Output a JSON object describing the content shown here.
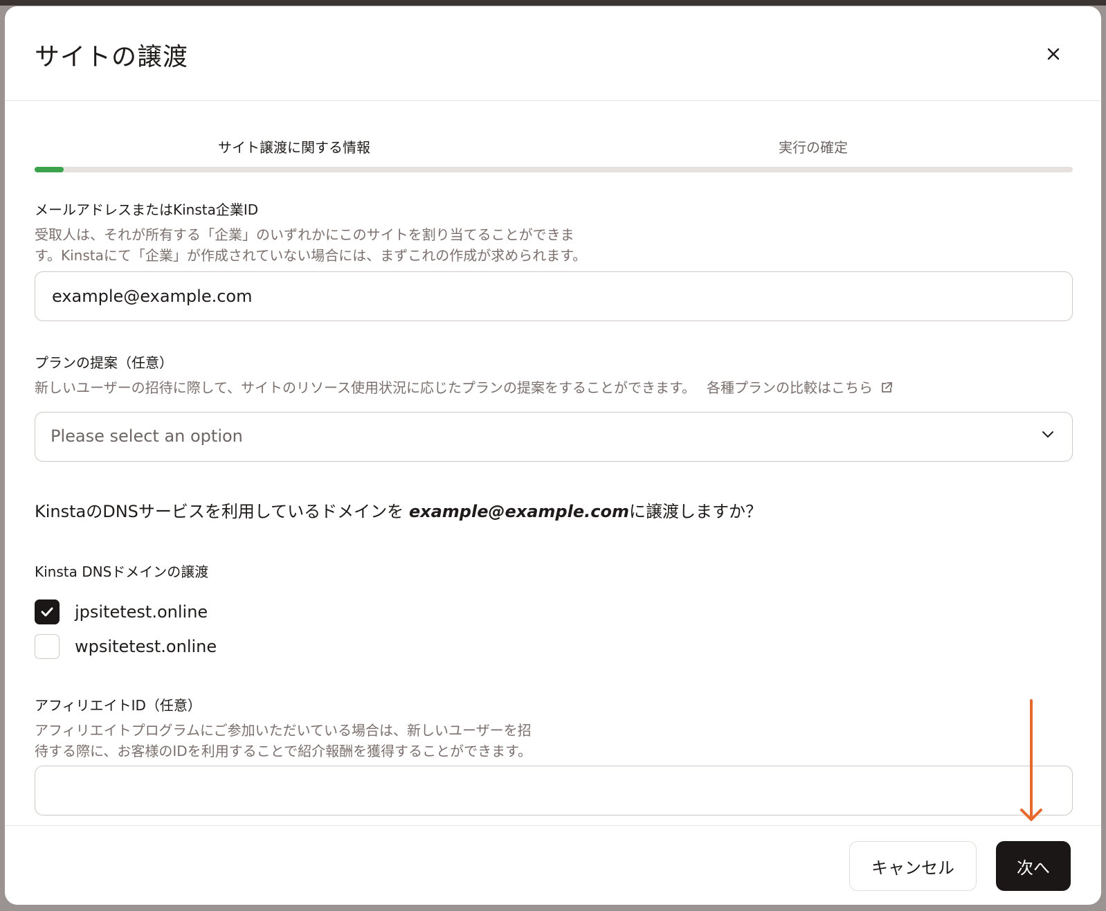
{
  "modal": {
    "title": "サイトの譲渡",
    "steps": [
      {
        "label": "サイト譲渡に関する情報"
      },
      {
        "label": "実行の確定"
      }
    ],
    "progress_fraction": 0.028
  },
  "email_field": {
    "label": "メールアドレスまたはKinsta企業ID",
    "help_line1": "受取人は、それが所有する「企業」のいずれかにこのサイトを割り当てることができま",
    "help_line2": "す。Kinstaにて「企業」が作成されていない場合には、まずこれの作成が求められます。",
    "value": "example@example.com"
  },
  "plan_field": {
    "label": "プランの提案（任意）",
    "help": "新しいユーザーの招待に際して、サイトのリソース使用状況に応じたプランの提案をすることができます。",
    "compare_link": "各種プランの比較はこちら",
    "placeholder": "Please select an option"
  },
  "dns_question": {
    "prefix": "KinstaのDNSサービスを利用しているドメインを ",
    "email": "example@example.com",
    "suffix": "に譲渡しますか？"
  },
  "dns_domains": {
    "label": "Kinsta DNSドメインの譲渡",
    "items": [
      {
        "name": "jpsitetest.online",
        "checked": true
      },
      {
        "name": "wpsitetest.online",
        "checked": false
      }
    ]
  },
  "affiliate_field": {
    "label": "アフィリエイトID（任意）",
    "help_line1": "アフィリエイトプログラムにご参加いただいている場合は、新しいユーザーを招",
    "help_line2": "待する際に、お客様のIDを利用することで紹介報酬を獲得することができます。",
    "value": ""
  },
  "footer": {
    "cancel_label": "キャンセル",
    "next_label": "次へ"
  },
  "colors": {
    "progress": "#3aa24a",
    "primary_button": "#1a1716",
    "annotation_arrow": "#e8692e"
  }
}
